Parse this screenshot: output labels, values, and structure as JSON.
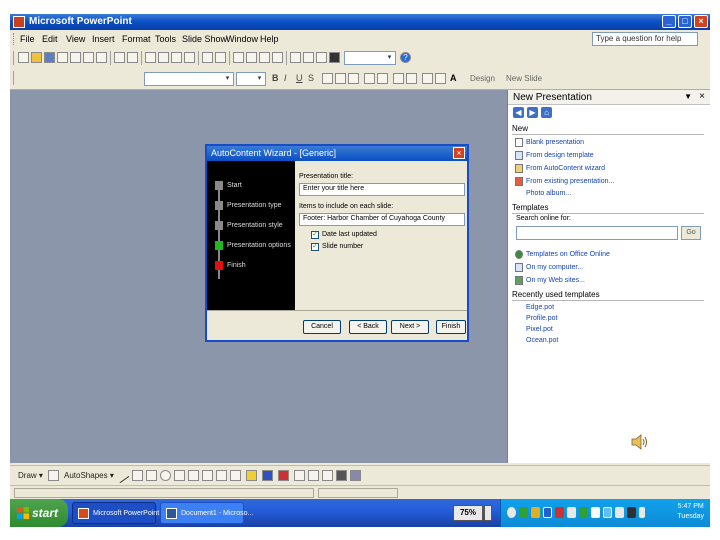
{
  "window": {
    "title": "Microsoft PowerPoint",
    "minimize": "_",
    "maximize": "□",
    "close": "×"
  },
  "menu": {
    "items": [
      "File",
      "Edit",
      "View",
      "Insert",
      "Format",
      "Tools",
      "Slide Show",
      "Window",
      "Help"
    ],
    "help_placeholder": "Type a question for help"
  },
  "toolbar": {
    "zoom_arrow": "▾",
    "help_btn": "?",
    "font_arrow": "▾",
    "size_arrow": "▾",
    "bold": "B",
    "italic": "I",
    "underline": "U",
    "shadow": "S",
    "font_color": "A",
    "design_label": "Design",
    "new_slide_label": "New Slide"
  },
  "taskpane": {
    "title": "New Presentation",
    "dropdown": "▼",
    "close": "×",
    "nav": [
      "◀",
      "▶",
      "⌂"
    ],
    "new_section": "New",
    "new_links": [
      "Blank presentation",
      "From design template",
      "From AutoContent wizard",
      "From existing presentation...",
      "Photo album..."
    ],
    "templates_section": "Templates",
    "search_label": "Search online for:",
    "go_label": "Go",
    "template_links": [
      "Templates on Office Online",
      "On my computer...",
      "On my Web sites..."
    ],
    "recent_section": "Recently used templates",
    "recent_links": [
      "Edge.pot",
      "Profile.pot",
      "Pixel.pot",
      "Ocean.pot"
    ]
  },
  "dialog": {
    "title": "AutoContent Wizard - [Generic]",
    "close": "×",
    "steps": [
      {
        "label": "Start",
        "color": "#8a8a8a"
      },
      {
        "label": "Presentation type",
        "color": "#8a8a8a"
      },
      {
        "label": "Presentation style",
        "color": "#8a8a8a"
      },
      {
        "label": "Presentation options",
        "color": "#21b821"
      },
      {
        "label": "Finish",
        "color": "#e01010"
      }
    ],
    "title_label": "Presentation title:",
    "title_value": "Enter your title here",
    "include_label": "Items to include on each slide:",
    "footer_value": "Footer: Harbor Chamber of Cuyahoga County",
    "last_updated_label": "Date last updated",
    "slide_number_label": "Slide number",
    "last_updated_checked": "✓",
    "slide_number_checked": "✓",
    "buttons": {
      "cancel": "Cancel",
      "back": "< Back",
      "next": "Next >",
      "finish": "Finish"
    }
  },
  "drawing_toolbar": {
    "draw": "Draw ▾",
    "autoshapes": "AutoShapes ▾"
  },
  "taskbar": {
    "start": "start",
    "items": [
      {
        "label": "Microsoft PowerPoint",
        "color": "#1d4ec4"
      },
      {
        "label": "Document1 - Microso...",
        "color": "#3c81f3"
      }
    ],
    "zoom": "75%",
    "clock_time": "5:47 PM",
    "clock_day": "Tuesday"
  },
  "colors": {
    "title_bar": "#0a4fc4",
    "workspace": "#8c96aa",
    "taskbar": "#245edb",
    "start_button": "#3c973c"
  }
}
